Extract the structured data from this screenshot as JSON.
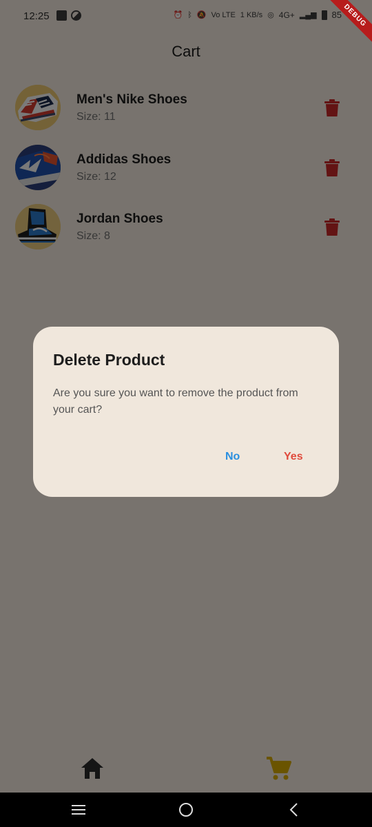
{
  "status_bar": {
    "time": "12:25",
    "network": "4G+",
    "volte": "Vo LTE",
    "speed": "1 KB/s",
    "battery": "85"
  },
  "debug_banner": "DEBUG",
  "header": {
    "title": "Cart"
  },
  "cart": {
    "items": [
      {
        "name": "Men's Nike Shoes",
        "size": "Size: 11",
        "image": "red-white-sneaker"
      },
      {
        "name": "Addidas Shoes",
        "size": "Size: 12",
        "image": "blue-sneaker"
      },
      {
        "name": "Jordan Shoes",
        "size": "Size: 8",
        "image": "jordan-high-top"
      }
    ]
  },
  "dialog": {
    "title": "Delete Product",
    "message": "Are you sure you want to remove the product from your cart?",
    "no_label": "No",
    "yes_label": "Yes"
  },
  "bottom_nav": {
    "items": [
      {
        "icon": "home-icon",
        "active": false
      },
      {
        "icon": "cart-icon",
        "active": true
      }
    ]
  },
  "colors": {
    "background": "#f0e7dc",
    "delete": "#c62828",
    "active_nav": "#d4a800",
    "dialog_no": "#2a8fe0",
    "dialog_yes": "#e04a3c",
    "scrim": "rgba(0,0,0,0.5)"
  }
}
